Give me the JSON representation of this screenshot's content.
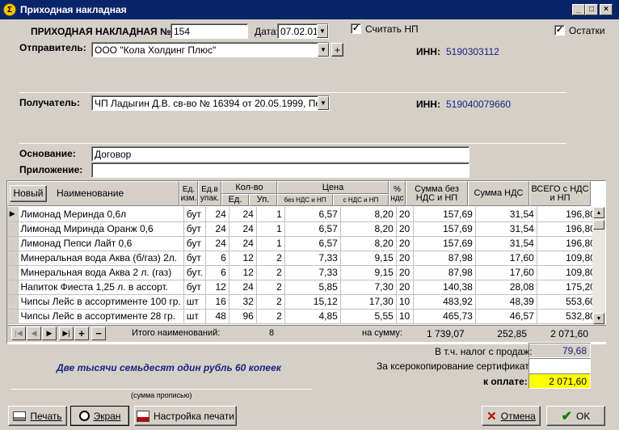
{
  "window": {
    "title": "Приходная накладная",
    "min": "_",
    "max": "□",
    "close": "×"
  },
  "header": {
    "doc_label": "ПРИХОДНАЯ НАКЛАДНАЯ №",
    "doc_number": "154",
    "date_label": "Дата:",
    "date_value": "07.02.01",
    "count_np_label": "Считать НП",
    "count_np_checked": "✓",
    "remains_label": "Остатки",
    "remains_checked": "✓",
    "sender_label": "Отправитель:",
    "sender_value": "ООО \"Кола Холдинг Плюс\"",
    "sender_add": "+",
    "inn_label": "ИНН:",
    "sender_inn": "5190303112",
    "receiver_label": "Получатель:",
    "receiver_value": "ЧП Ладыгин Д.В. св-во № 16394 от 20.05.1999, Перво",
    "receiver_inn": "519040079660",
    "basis_label": "Основание:",
    "basis_value": "Договор",
    "attachment_label": "Приложение:",
    "attachment_value": ""
  },
  "table": {
    "new_button": "Новый",
    "headers": {
      "name": "Наименование",
      "unit": "Ед. изм.",
      "pack": "Ед.в упак.",
      "qty": "Кол-во",
      "qty_unit": "Ед.",
      "qty_pack": "Уп.",
      "price": "Цена",
      "price_no_vat": "без НДС и НП",
      "price_vat": "с НДС и НП",
      "pct": "% ндс",
      "sum_no_vat": "Сумма без НДС и НП",
      "sum_vat": "Сумма НДС",
      "total": "ВСЕГО с НДС и НП"
    },
    "rows": [
      {
        "name": "Лимонад Меринда 0,6л",
        "unit": "бут",
        "pack": "24",
        "qty": "24",
        "packs": "1",
        "price": "6,57",
        "price_vat": "8,20",
        "pct": "20",
        "sum": "157,69",
        "vat": "31,54",
        "total": "196,80"
      },
      {
        "name": "Лимонад Миринда Оранж 0,6",
        "unit": "бут",
        "pack": "24",
        "qty": "24",
        "packs": "1",
        "price": "6,57",
        "price_vat": "8,20",
        "pct": "20",
        "sum": "157,69",
        "vat": "31,54",
        "total": "196,80"
      },
      {
        "name": "Лимонад Пепси Лайт 0,6",
        "unit": "бут",
        "pack": "24",
        "qty": "24",
        "packs": "1",
        "price": "6,57",
        "price_vat": "8,20",
        "pct": "20",
        "sum": "157,69",
        "vat": "31,54",
        "total": "196,80"
      },
      {
        "name": "Минеральная вода Аква (б/газ) 2л.",
        "unit": "бут",
        "pack": "6",
        "qty": "12",
        "packs": "2",
        "price": "7,33",
        "price_vat": "9,15",
        "pct": "20",
        "sum": "87,98",
        "vat": "17,60",
        "total": "109,80"
      },
      {
        "name": "Минеральная вода Аква 2 л. (газ)",
        "unit": "бут.",
        "pack": "6",
        "qty": "12",
        "packs": "2",
        "price": "7,33",
        "price_vat": "9,15",
        "pct": "20",
        "sum": "87,98",
        "vat": "17,60",
        "total": "109,80"
      },
      {
        "name": "Напиток Фиеста 1,25 л. в ассорт.",
        "unit": "бут",
        "pack": "12",
        "qty": "24",
        "packs": "2",
        "price": "5,85",
        "price_vat": "7,30",
        "pct": "20",
        "sum": "140,38",
        "vat": "28,08",
        "total": "175,20"
      },
      {
        "name": "Чипсы Лейс в ассортименте 100 гр.",
        "unit": "шт",
        "pack": "16",
        "qty": "32",
        "packs": "2",
        "price": "15,12",
        "price_vat": "17,30",
        "pct": "10",
        "sum": "483,92",
        "vat": "48,39",
        "total": "553,60"
      },
      {
        "name": "Чипсы Лейс в ассортименте 28 гр.",
        "unit": "шт",
        "pack": "48",
        "qty": "96",
        "packs": "2",
        "price": "4,85",
        "price_vat": "5,55",
        "pct": "10",
        "sum": "465,73",
        "vat": "46,57",
        "total": "532,80"
      }
    ]
  },
  "footer": {
    "nav": [
      "|◀",
      "◀",
      "▶",
      "▶|",
      "+",
      "−"
    ],
    "items_label": "Итого наименований:",
    "items_count": "8",
    "sum_label": "на сумму:",
    "sum_no_vat": "1 739,07",
    "sum_vat": "252,85",
    "sum_total": "2 071,60",
    "sales_tax_label": "В т.ч. налог с продаж:",
    "sales_tax_value": "79,68",
    "copy_label": "За ксерокопирование сертификатов:",
    "copy_value": "",
    "pay_label": "к оплате:",
    "pay_value": "2 071,60",
    "words": "Две тысячи семьдесят один рубль 60 копеек",
    "words_caption": "(сумма прописью)"
  },
  "buttons": {
    "print": "Печать",
    "screen": "Экран",
    "print_setup": "Настройка печати",
    "cancel": "Отмена",
    "ok": "OK"
  }
}
